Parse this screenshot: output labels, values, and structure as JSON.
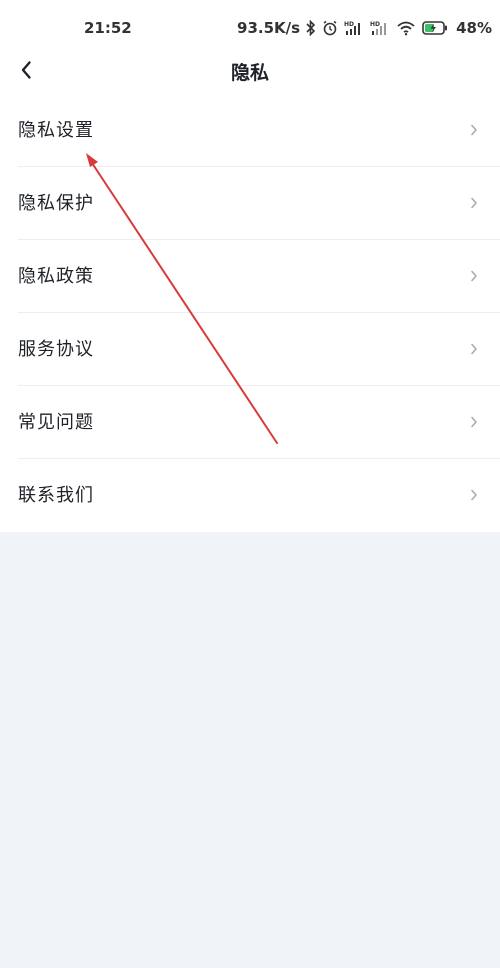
{
  "status_bar": {
    "time": "21:52",
    "network_speed": "93.5K/s",
    "icons": [
      "bluetooth-icon",
      "alarm-icon",
      "hd-signal-icon",
      "hd-signal-icon",
      "wifi-icon",
      "battery-charging-icon"
    ],
    "battery_percent": "48%"
  },
  "nav": {
    "back_icon": "chevron-left-icon",
    "title": "隐私"
  },
  "menu": {
    "items": [
      {
        "label": "隐私设置"
      },
      {
        "label": "隐私保护"
      },
      {
        "label": "隐私政策"
      },
      {
        "label": "服务协议"
      },
      {
        "label": "常见问题"
      },
      {
        "label": "联系我们"
      }
    ]
  },
  "colors": {
    "background": "#f0f3f7",
    "surface": "#ffffff",
    "annotation_arrow": "#d93a3a"
  }
}
